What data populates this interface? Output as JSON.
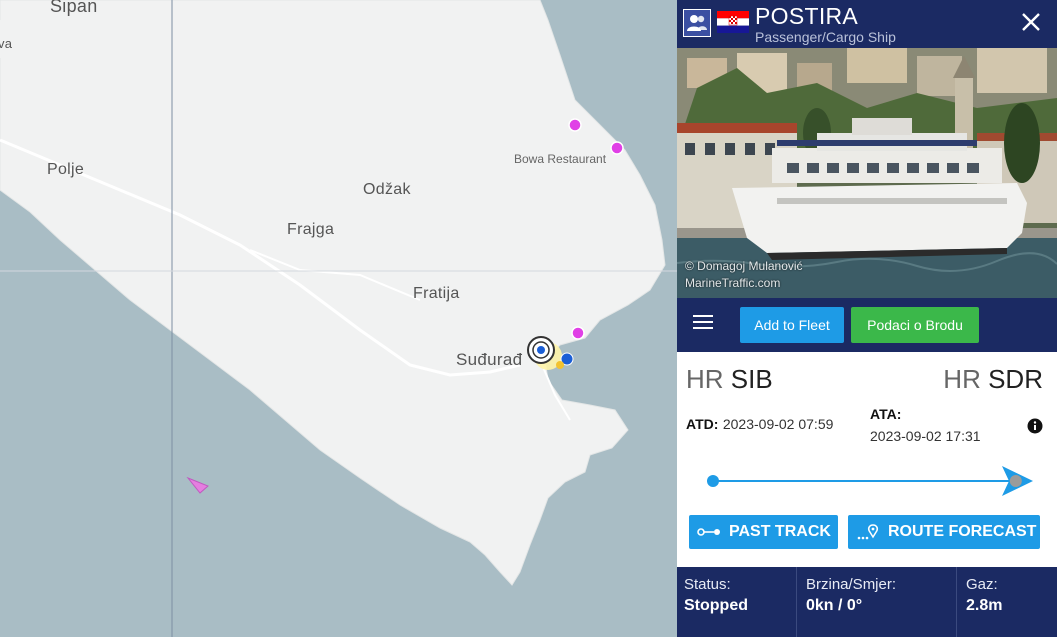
{
  "map": {
    "places": {
      "sipan": "Sipan",
      "polje": "Polje",
      "odzak": "Odžak",
      "frajga": "Frajga",
      "fratija": "Fratija",
      "suduradj": "Suđurađ",
      "bowa": "Bowa Restaurant",
      "va": "va"
    }
  },
  "vessel": {
    "name": "POSTIRA",
    "type": "Passenger/Cargo Ship",
    "flag": "Croatia",
    "photo_credit_line1": "© Domagoj Mulanović",
    "photo_credit_line2": "MarineTraffic.com"
  },
  "toolbar": {
    "add_fleet_label": "Add to Fleet",
    "vessel_info_label": "Podaci o Brodu"
  },
  "voyage": {
    "departure": {
      "country": "HR",
      "code": "SIB"
    },
    "arrival": {
      "country": "HR",
      "code": "SDR"
    },
    "atd_label": "ATD:",
    "atd_value": "2023-09-02 07:59",
    "ata_label": "ATA:",
    "ata_value": "2023-09-02 17:31",
    "progress": 0.98
  },
  "actions": {
    "past_track_label": "PAST TRACK",
    "route_forecast_label": "ROUTE FORECAST"
  },
  "stats": {
    "status_label": "Status:",
    "status_value": "Stopped",
    "speed_label": "Brzina/Smjer:",
    "speed_value": "0kn / 0°",
    "draught_label": "Gaz:",
    "draught_value": "2.8m"
  },
  "colors": {
    "panel_dark": "#1b2a63",
    "accent_blue": "#1e9be6",
    "accent_green": "#3bb84a",
    "land": "#f1f2f2",
    "sea": "#a9bdc5"
  }
}
